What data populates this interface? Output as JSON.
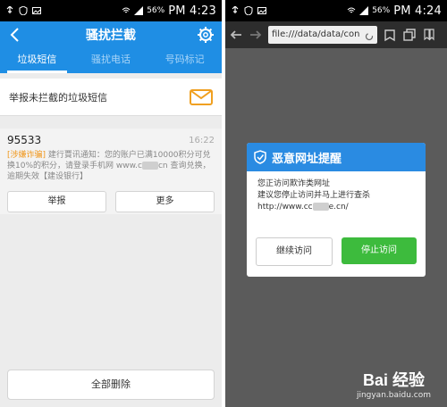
{
  "left": {
    "status": {
      "battery": "56%",
      "time": "PM 4:23"
    },
    "header": {
      "title": "骚扰拦截"
    },
    "tabs": [
      {
        "label": "垃圾短信",
        "active": true
      },
      {
        "label": "骚扰电话",
        "active": false
      },
      {
        "label": "号码标记",
        "active": false
      }
    ],
    "report": {
      "label": "举报未拦截的垃圾短信"
    },
    "message": {
      "sender": "95533",
      "time": "16:22",
      "tag": "[涉嫌诈骗]",
      "body_part1": "建行賈讯通知：您的账户已满10000积分可兑换10%的积分，请登录手机网 www.c",
      "body_part2": "cn 查询兑换，逾期失效【建设银行】"
    },
    "actions": {
      "report": "举报",
      "more": "更多"
    },
    "delete_all": "全部删除"
  },
  "right": {
    "status": {
      "battery": "56%",
      "time": "PM 4:24"
    },
    "url": "file:///data/data/con",
    "dialog": {
      "title": "恶意网址提醒",
      "line1": "您正访问欺诈类网址",
      "line2": "建议您停止访问并马上进行查杀",
      "url_part1": "http://www.cc",
      "url_part2": "e.cn/",
      "continue": "继续访问",
      "stop": "停止访问"
    },
    "watermark": {
      "logo": "Bai 经验",
      "site": "jingyan.baidu.com"
    }
  },
  "colors": {
    "header_blue": "#1f8ee4",
    "dialog_blue": "#2a8be2",
    "stop_green": "#3dbb3d",
    "tag_orange": "#f0961a"
  }
}
